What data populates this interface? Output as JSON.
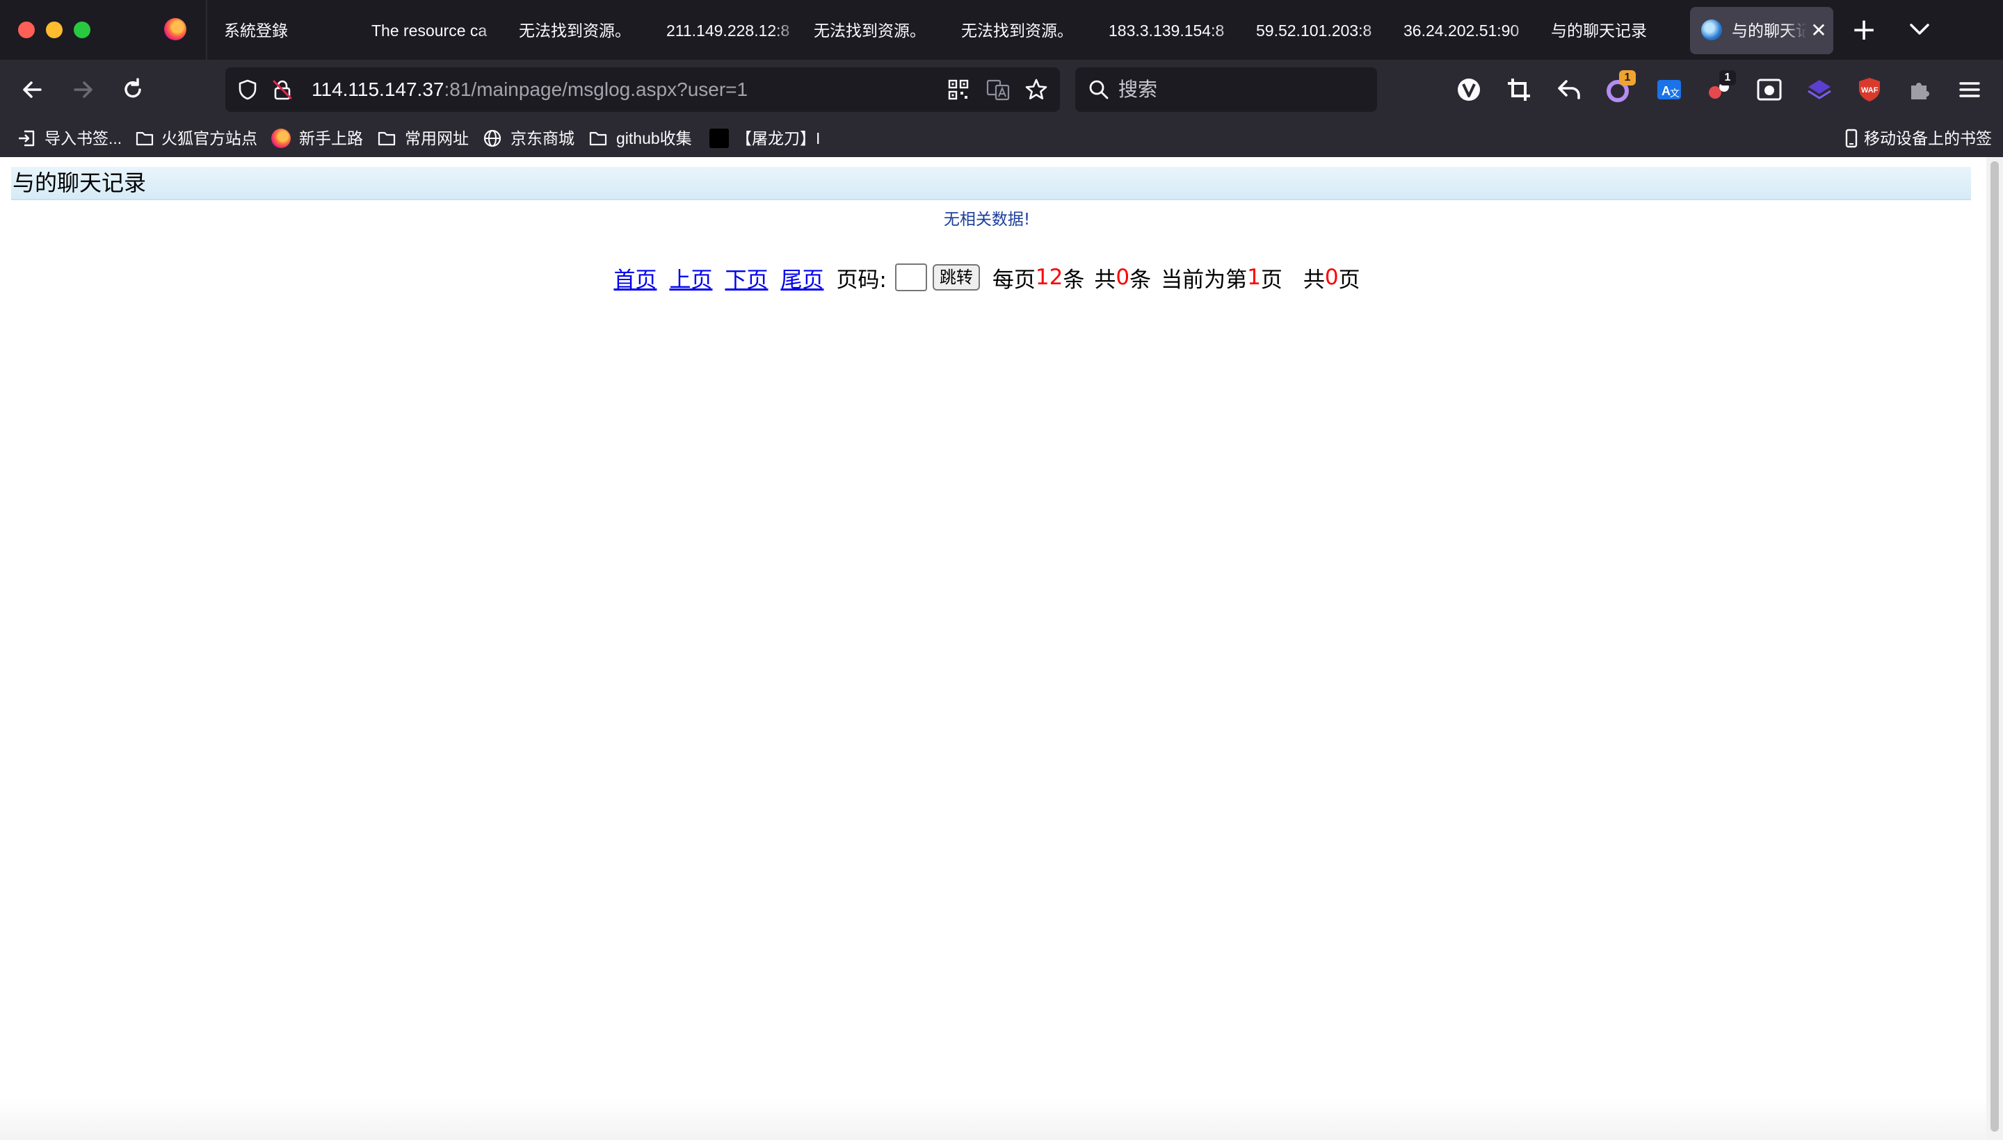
{
  "browser": {
    "tabs": [
      {
        "label": "系統登錄"
      },
      {
        "label": "The resource ca"
      },
      {
        "label": "无法找到资源。"
      },
      {
        "label": "211.149.228.12:8"
      },
      {
        "label": "无法找到资源。"
      },
      {
        "label": "无法找到资源。"
      },
      {
        "label": "183.3.139.154:8"
      },
      {
        "label": "59.52.101.203:8"
      },
      {
        "label": "36.24.202.51:90"
      },
      {
        "label": "与的聊天记录"
      }
    ],
    "active_tab": {
      "label": "与的聊天记",
      "close": "✕"
    },
    "new_tab": "+",
    "url": {
      "host": "114.115.147.37",
      "rest": ":81/mainpage/msglog.aspx?user=1"
    },
    "search_placeholder": "搜索",
    "extension_badges": {
      "first": "1",
      "second": "1"
    },
    "bookmarks": [
      {
        "label": "导入书签..."
      },
      {
        "label": "火狐官方站点"
      },
      {
        "label": "新手上路"
      },
      {
        "label": "常用网址"
      },
      {
        "label": "京东商城"
      },
      {
        "label": "github收集"
      },
      {
        "label": "【屠龙刀】I"
      }
    ],
    "mobile_bookmarks": "移动设备上的书签"
  },
  "page": {
    "title": "与的聊天记录",
    "empty_message": "无相关数据!",
    "pager": {
      "first": "首页",
      "prev": "上页",
      "next": "下页",
      "last": "尾页",
      "page_label": "页码:",
      "jump_button": "跳转",
      "per_page_prefix": "每页",
      "per_page": "12",
      "per_page_suffix": "条",
      "total_prefix": "共",
      "total": "0",
      "total_suffix": "条",
      "current_prefix": "当前为第",
      "current": "1",
      "current_suffix": "页",
      "pages_prefix": "共",
      "pages": "0",
      "pages_suffix": "页"
    }
  },
  "colors": {
    "chrome_dark": "#1c1b22",
    "toolbar": "#2b2a33",
    "link": "#0000ee",
    "highlight_number": "#ff0000",
    "empty_message": "#1b3f9b",
    "title_bar": "#e1f0f9"
  }
}
